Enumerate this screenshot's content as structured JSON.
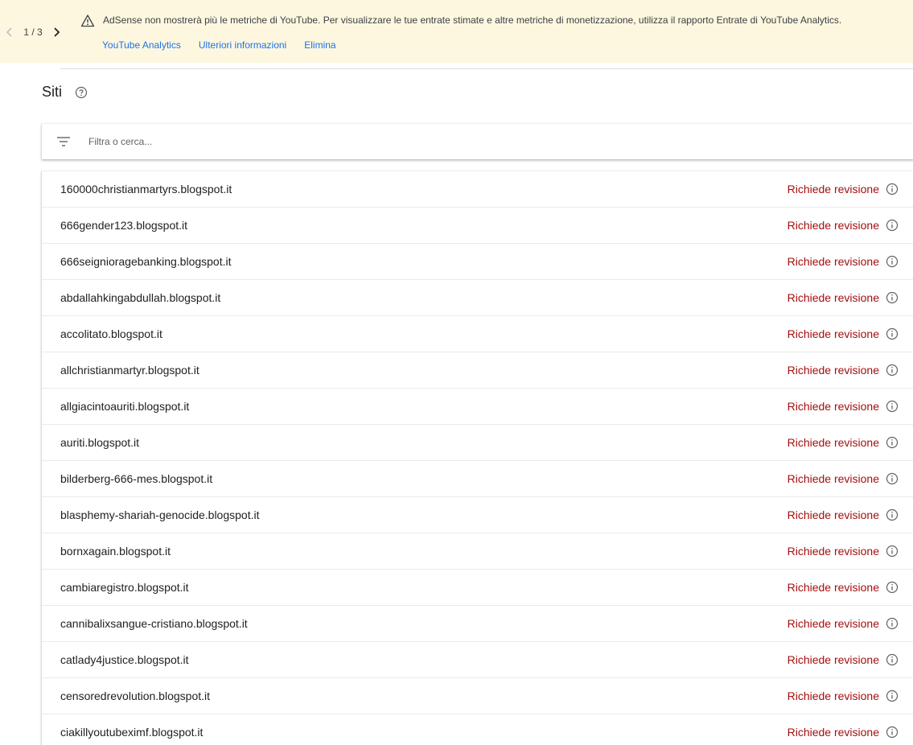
{
  "banner": {
    "pager": {
      "current_of_total": "1 / 3"
    },
    "message": "AdSense non mostrerà più le metriche di YouTube. Per visualizzare le tue entrate stimate e altre metriche di monetizzazione, utilizza il rapporto Entrate di YouTube Analytics.",
    "actions": [
      "YouTube Analytics",
      "Ulteriori informazioni",
      "Elimina"
    ],
    "background_color": "#fef7e0",
    "link_color": "#1a73e8"
  },
  "page": {
    "title": "Siti",
    "help_icon": "help-circle-icon"
  },
  "filter": {
    "icon": "filter-icon",
    "placeholder": "Filtra o cerca...",
    "value": ""
  },
  "sites": {
    "status_color": "#a50e0e",
    "rows": [
      {
        "name": "160000christianmartyrs.blogspot.it",
        "status": "Richiede revisione"
      },
      {
        "name": "666gender123.blogspot.it",
        "status": "Richiede revisione"
      },
      {
        "name": "666seignioragebanking.blogspot.it",
        "status": "Richiede revisione"
      },
      {
        "name": "abdallahkingabdullah.blogspot.it",
        "status": "Richiede revisione"
      },
      {
        "name": "accolitato.blogspot.it",
        "status": "Richiede revisione"
      },
      {
        "name": "allchristianmartyr.blogspot.it",
        "status": "Richiede revisione"
      },
      {
        "name": "allgiacintoauriti.blogspot.it",
        "status": "Richiede revisione"
      },
      {
        "name": "auriti.blogspot.it",
        "status": "Richiede revisione"
      },
      {
        "name": "bilderberg-666-mes.blogspot.it",
        "status": "Richiede revisione"
      },
      {
        "name": "blasphemy-shariah-genocide.blogspot.it",
        "status": "Richiede revisione"
      },
      {
        "name": "bornxagain.blogspot.it",
        "status": "Richiede revisione"
      },
      {
        "name": "cambiaregistro.blogspot.it",
        "status": "Richiede revisione"
      },
      {
        "name": "cannibalixsangue-cristiano.blogspot.it",
        "status": "Richiede revisione"
      },
      {
        "name": "catlady4justice.blogspot.it",
        "status": "Richiede revisione"
      },
      {
        "name": "censoredrevolution.blogspot.it",
        "status": "Richiede revisione"
      },
      {
        "name": "ciakillyoutubeximf.blogspot.it",
        "status": "Richiede revisione"
      }
    ]
  }
}
